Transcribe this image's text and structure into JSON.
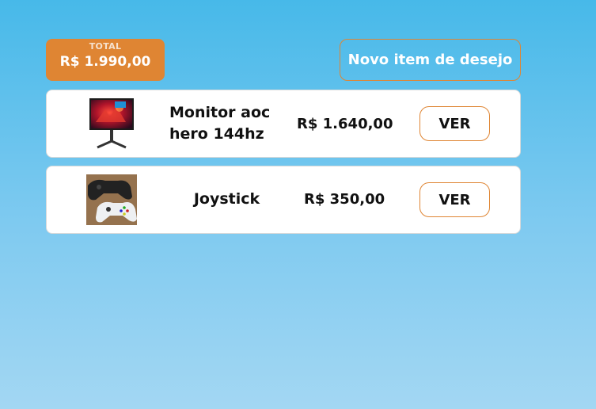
{
  "total": {
    "label": "TOTAL",
    "value": "R$ 1.990,00"
  },
  "new_item_button": "Novo item de desejo",
  "items": [
    {
      "name": "Monitor aoc hero 144hz",
      "price": "R$ 1.640,00",
      "action": "VER",
      "image_icon": "monitor-icon"
    },
    {
      "name": "Joystick",
      "price": "R$ 350,00",
      "action": "VER",
      "image_icon": "gamepad-icon"
    }
  ],
  "colors": {
    "accent": "#df8533",
    "background_top": "#47b9e9",
    "background_bottom": "#a3d7f3",
    "card": "#ffffff"
  }
}
